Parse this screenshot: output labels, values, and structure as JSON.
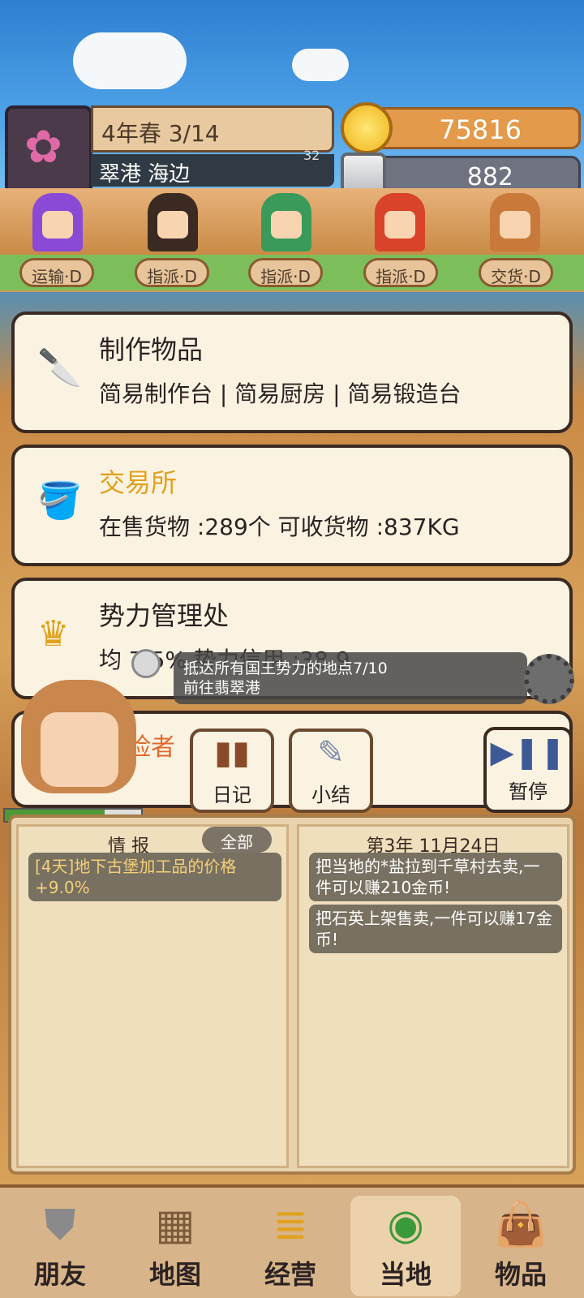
{
  "hud": {
    "date": "4年春 3/14",
    "location": "翠港 海边",
    "gold": "75816",
    "silver": "882",
    "small_number": "32"
  },
  "roles": [
    "运输·D",
    "指派·D",
    "指派·D",
    "指派·D",
    "交货·D"
  ],
  "cards": {
    "crafting": {
      "title": "制作物品",
      "sub": "简易制作台 | 简易厨房 | 简易锻造台"
    },
    "market": {
      "title": "交易所",
      "sub": "在售货物 :289个  可收货物 :837KG"
    },
    "faction": {
      "title": "势力管理处",
      "sub": "均 7.5%  势力信用 :38.9"
    },
    "adventure": {
      "title": "险者"
    }
  },
  "quest": {
    "line1": "抵达所有国王势力的地点7/10",
    "line2": "前往翡翠港"
  },
  "buttons": {
    "diary": "日记",
    "summary": "小结",
    "pause": "暂停"
  },
  "book": {
    "left_header": "情 报",
    "filter_label": "全部",
    "left_news": [
      "[4天]地下古堡加工品的价格+9.0%"
    ],
    "right_header": "第3年 11月24日",
    "right_news": [
      "把当地的*盐拉到千草村去卖,一件可以赚210金币!",
      "把石英上架售卖,一件可以赚17金币!"
    ]
  },
  "nav": [
    "朋友",
    "地图",
    "经营",
    "当地",
    "物品"
  ],
  "colors": {
    "accent_gold": "#e0a21e",
    "health_green": "#4d9a36"
  },
  "player_health_fraction": 0.73
}
